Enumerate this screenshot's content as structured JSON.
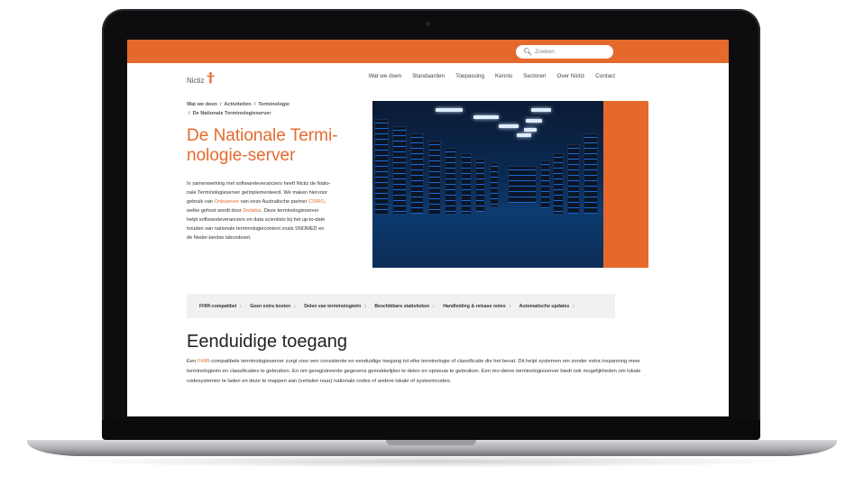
{
  "topbar": {
    "accent": "#e5692c",
    "search": {
      "icon": "search-icon",
      "placeholder": "Zoeken"
    }
  },
  "logo": {
    "text": "Nictiz",
    "icon": "nictiz-figure-icon"
  },
  "nav": {
    "items": [
      "Wat we doen",
      "Standaarden",
      "Toepassing",
      "Kennis",
      "Sectoren",
      "Over Nictiz",
      "Contact"
    ]
  },
  "breadcrumb": {
    "items": [
      "Wat we doen",
      "Activiteiten",
      "Terminologie",
      "De Nationale Terminologieserver"
    ]
  },
  "hero": {
    "title_line1": "De Nationale Termi-",
    "title_line2": "nologie-server",
    "image_alt": "server-room-photo"
  },
  "intro": {
    "p1": "In samenwerking met softwareleveranciers heeft Nictiz de Natio-nale Terminologieserver geïmplementeerd. We maken hiervoor gebruik van ",
    "link1": "Ontoserver",
    "p2": " van onze Australische partner ",
    "link2": "CSIRO",
    "p3": ", welke gehost wordt door ",
    "link3": "Dedalus",
    "p4": ". Deze terminologieserver helpt softwareleveranciers en data scientists bij het up-to-date houden van nationale terminologiecontent zoals SNOMED en de Neder-landse labcodeset."
  },
  "features": {
    "items": [
      "FHIR-compatibel",
      "Geen extra kosten",
      "Delen van terminologieën",
      "Beschikbare statistieken",
      "Handleiding & release notes",
      "Automatische updates"
    ],
    "chevron": "↓"
  },
  "section": {
    "heading": "Eenduidige toegang",
    "p_pre": "Een ",
    "p_link": "FHIR",
    "p_post": "-compatibele terminologieserver zorgt voor een consistente en eenduidige toegang tot elke terminologie of classificatie die het bevat. Dit helpt systemen om zonder extra inspanning meer terminologieën en classificaties te gebruiken. En om geregistreerde gegevens gemakkelijker te delen en opnieuw te gebruiken. Een mo-derne terminologieserver biedt ook mogelijkheden om lokale codesystemen te laden en deze te mappen aan (vertalen naar) nationale codes of andere lokale of systeemcodes."
  }
}
